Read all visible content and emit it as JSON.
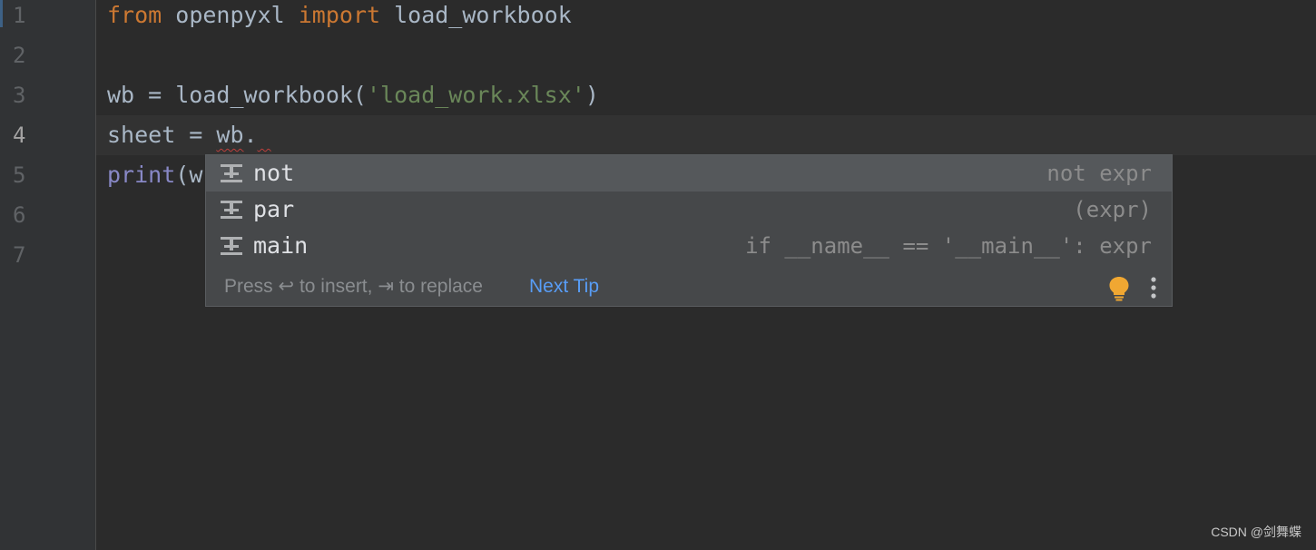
{
  "editor": {
    "line_numbers": [
      "1",
      "2",
      "3",
      "4",
      "5",
      "6",
      "7"
    ],
    "current_line": "4",
    "lines": {
      "l1": {
        "kw_from": "from",
        "mod": " openpyxl ",
        "kw_import": "import",
        "name": " load_workbook"
      },
      "l3": {
        "pre": "wb = load_workbook(",
        "str": "'load_work.xlsx'",
        "post": ")"
      },
      "l4": {
        "pre": "sheet = ",
        "err1": "wb",
        "mid": ".",
        "err2": " "
      },
      "l5": {
        "builtin": "print",
        "post": "(w"
      }
    }
  },
  "completion_popup": {
    "items": [
      {
        "name": "not",
        "tail": "not expr",
        "icon": "postfix-template-icon",
        "selected": true
      },
      {
        "name": "par",
        "tail": "(expr)",
        "icon": "postfix-template-icon",
        "selected": false
      },
      {
        "name": "main",
        "tail": "if __name__ == '__main__': expr",
        "icon": "postfix-template-icon",
        "selected": false
      }
    ],
    "footer": {
      "hint": "Press ↩ to insert, ⇥ to replace",
      "next_tip": "Next Tip"
    }
  },
  "watermark": "CSDN @剑舞蝶",
  "colors": {
    "background": "#2b2b2b",
    "keyword": "#cc7832",
    "string": "#6a8759",
    "builtin": "#8888c6",
    "link": "#589df6",
    "bulb": "#f0a732"
  }
}
